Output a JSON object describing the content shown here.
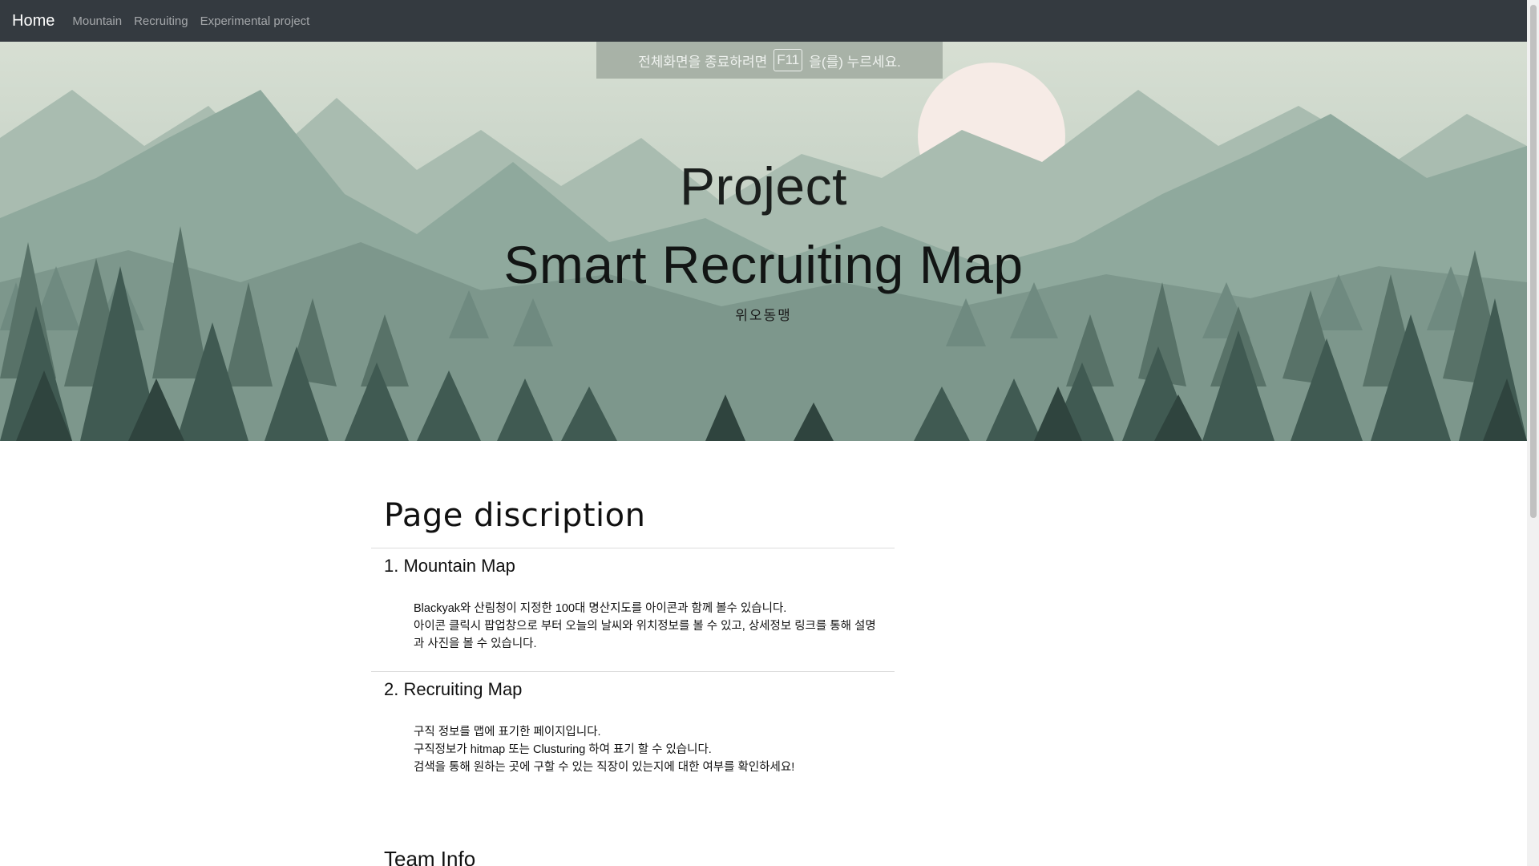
{
  "navbar": {
    "brand": "Home",
    "links": [
      "Mountain",
      "Recruiting",
      "Experimental project"
    ]
  },
  "fullscreen_notice": {
    "before": "전체화면을 종료하려면",
    "key": "F11",
    "after": "을(를) 누르세요."
  },
  "hero": {
    "line1": "Project",
    "line2": "Smart Recruiting Map",
    "subtitle": "위오동맹"
  },
  "main": {
    "page_title": "Page discription",
    "sections": [
      {
        "title": "1. Mountain Map",
        "lines": [
          "Blackyak와 산림청이 지정한 100대 명산지도를 아이콘과 함께 볼수 있습니다.",
          "아이콘 클릭시 팝업창으로 부터 오늘의 날씨와 위치정보를 볼 수 있고, 상세정보 링크를 통해 설명",
          "과 사진을 볼 수 있습니다."
        ]
      },
      {
        "title": "2. Recruiting Map",
        "lines": [
          "구직 정보를 맵에 표기한 페이지입니다.",
          "구직정보가 hitmap 또는 Clusturing 하여 표기 할 수 있습니다.",
          "검색을 통해 원하는 곳에 구할 수 있는 직장이 있는지에 대한 여부를 확인하세요!"
        ]
      }
    ],
    "team_title": "Team Info"
  },
  "colors": {
    "navbar_bg": "#343a40",
    "hero_sky": "#c6d3c5",
    "sun": "#f8ece8"
  }
}
